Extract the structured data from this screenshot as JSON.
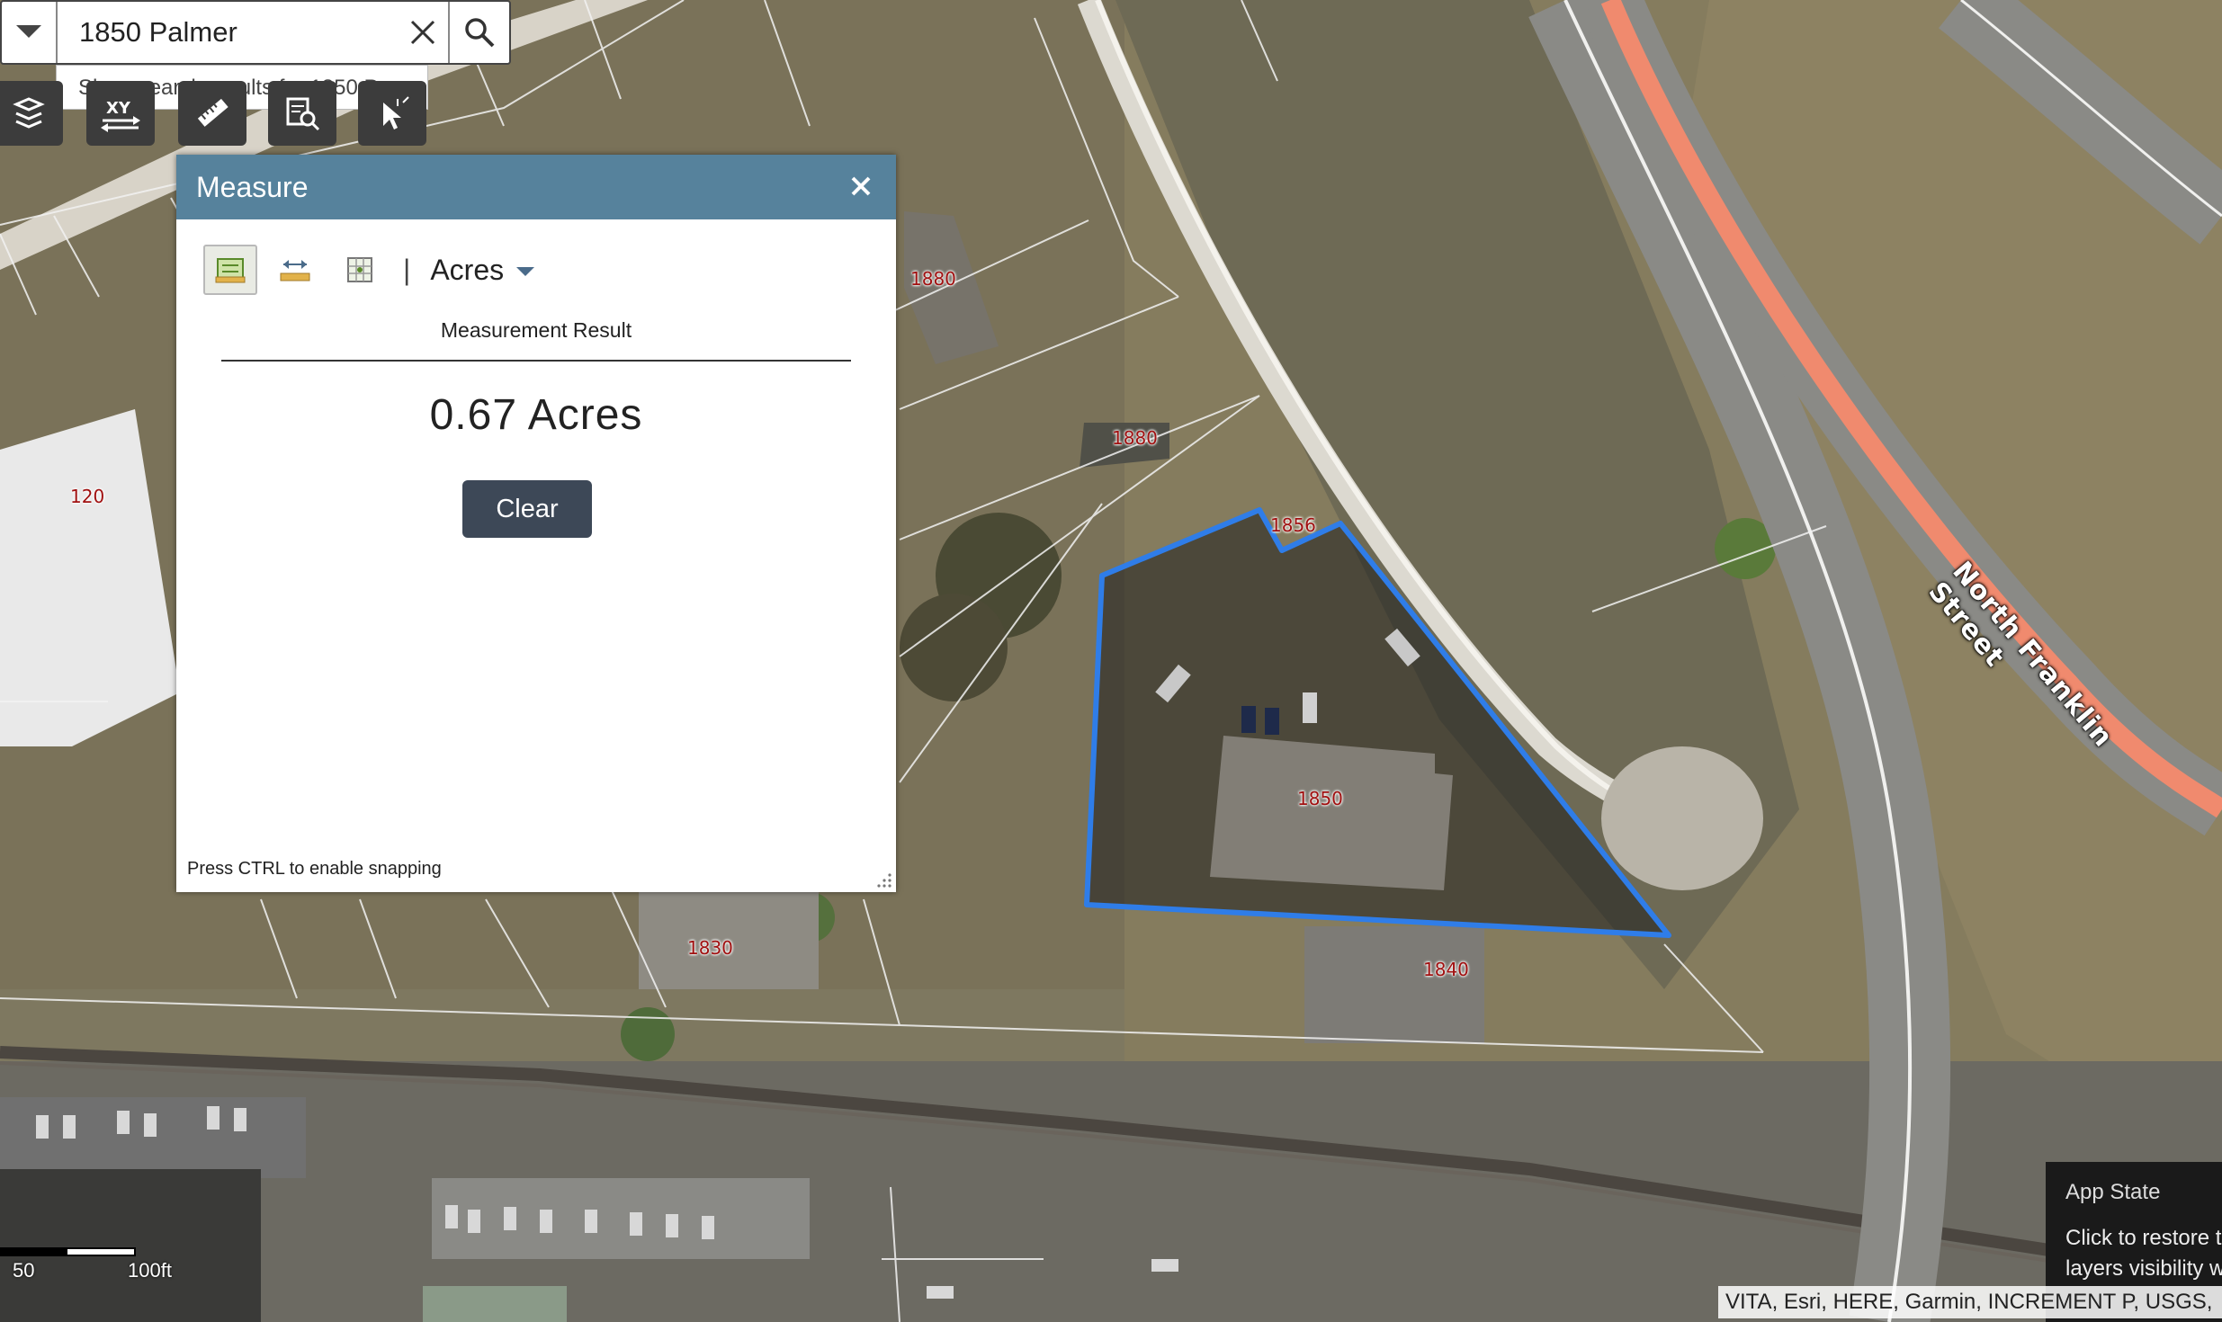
{
  "search": {
    "value": "1850 Palmer",
    "suggestion": "Show search results for 1850 P..."
  },
  "toolbar": {
    "tools": [
      {
        "name": "map-layers-icon"
      },
      {
        "name": "xy-coordinates-icon",
        "label": "XY"
      },
      {
        "name": "ruler-icon"
      },
      {
        "name": "search-by-attribute-icon"
      },
      {
        "name": "select-cursor-icon"
      }
    ]
  },
  "measure": {
    "title": "Measure",
    "unit": "Acres",
    "separator": "|",
    "result_title": "Measurement Result",
    "result_value": "0.67 Acres",
    "clear_label": "Clear",
    "snap_hint": "Press CTRL to enable snapping"
  },
  "map": {
    "parcels": [
      "120",
      "1880",
      "1880",
      "1856",
      "1850",
      "1830",
      "1840"
    ],
    "street": "North Franklin Street",
    "highlight_color": "#2f7de8"
  },
  "scalebar": {
    "labels": [
      "50",
      "100ft"
    ]
  },
  "app_state": {
    "title": "App State",
    "line1": "Click to restore t",
    "line2": "layers visibility w"
  },
  "attribution": "VITA, Esri, HERE, Garmin, INCREMENT P, USGS,"
}
